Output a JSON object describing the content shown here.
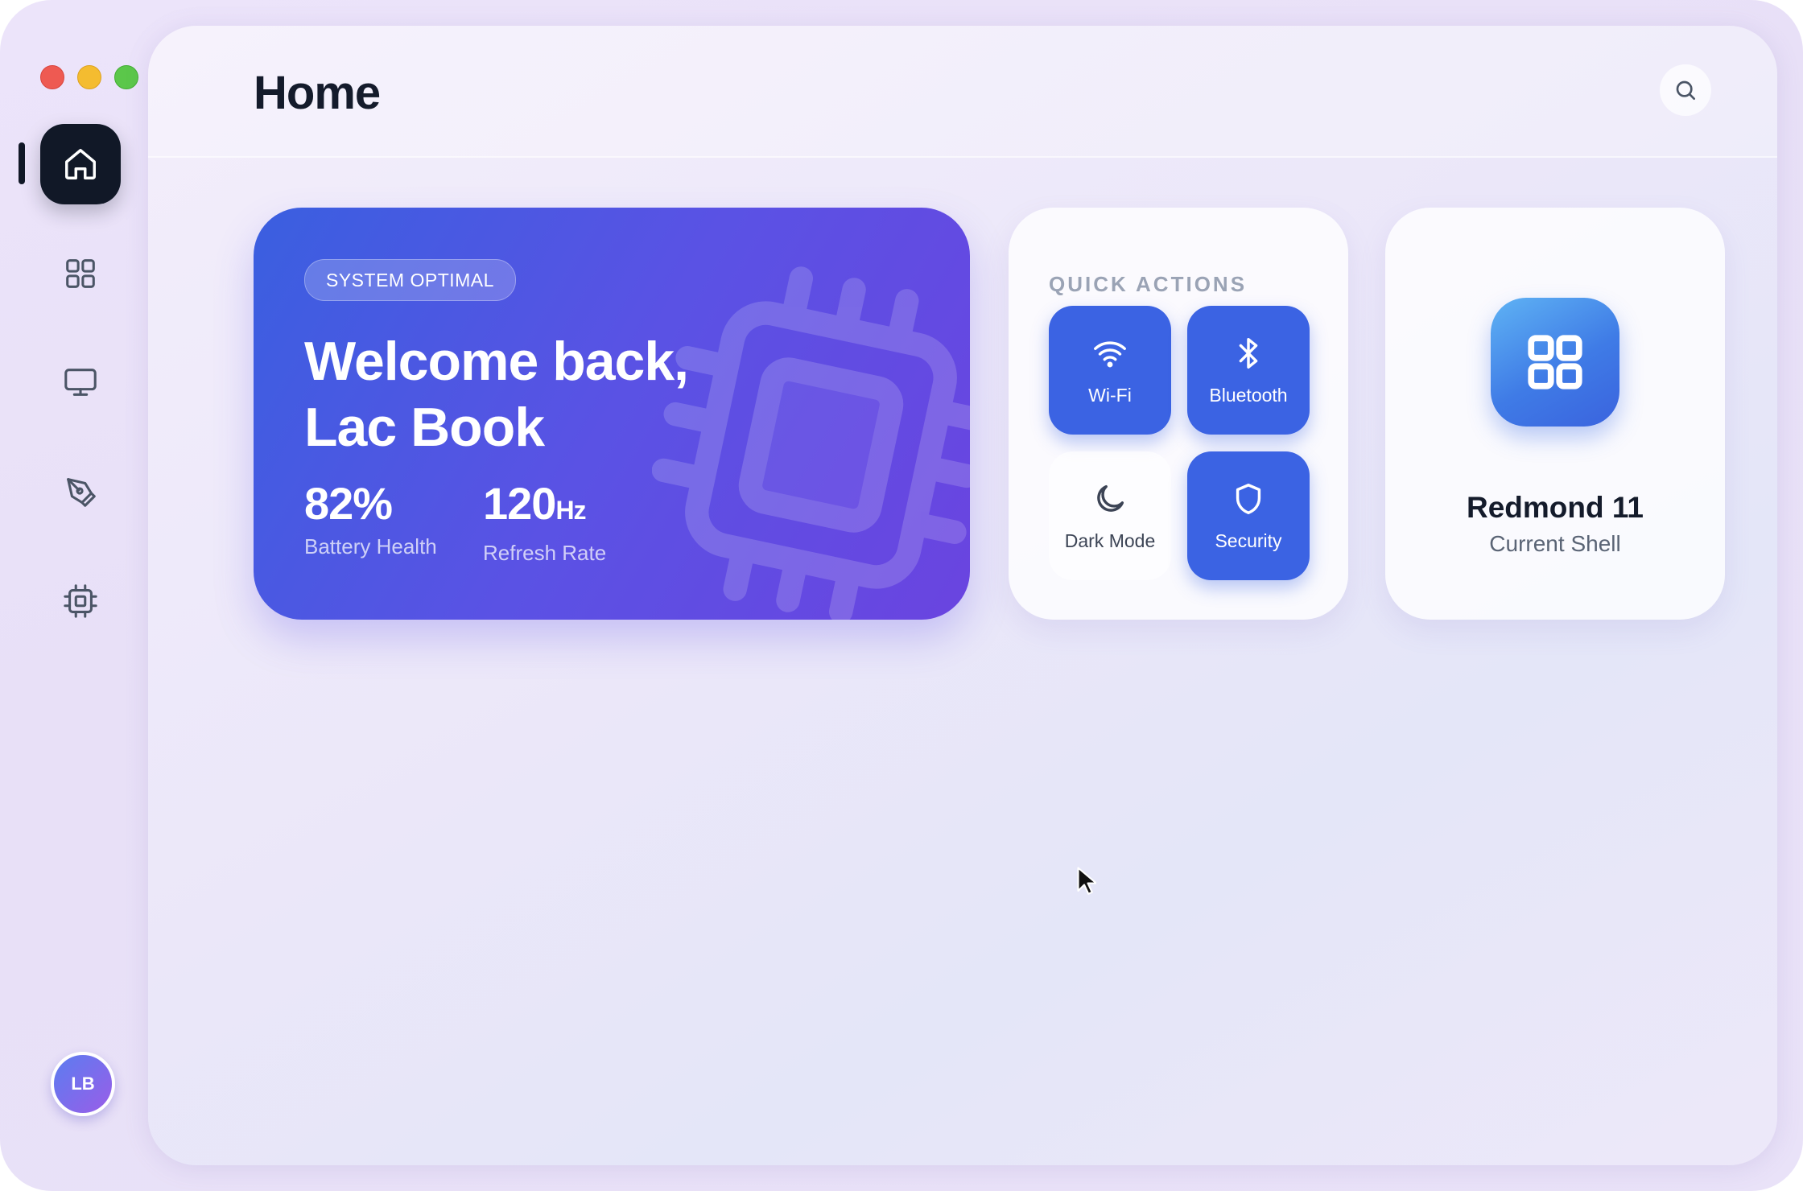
{
  "window": {
    "controls": [
      "close",
      "minimize",
      "maximize"
    ]
  },
  "sidebar": {
    "items": [
      {
        "id": "home",
        "icon": "home-icon",
        "active": true
      },
      {
        "id": "apps",
        "icon": "grid-icon",
        "active": false
      },
      {
        "id": "display",
        "icon": "monitor-icon",
        "active": false
      },
      {
        "id": "personalize",
        "icon": "pen-tool-icon",
        "active": false
      },
      {
        "id": "system",
        "icon": "cpu-icon",
        "active": false
      }
    ],
    "avatar_initials": "LB"
  },
  "header": {
    "title": "Home",
    "search_icon": "search-icon"
  },
  "hero": {
    "badge": "SYSTEM OPTIMAL",
    "title_line1": "Welcome back,",
    "title_line2": "Lac Book",
    "stats": [
      {
        "value": "82%",
        "unit": "",
        "label": "Battery Health"
      },
      {
        "value": "120",
        "unit": "Hz",
        "label": "Refresh Rate"
      }
    ],
    "gradient": [
      "#3a5fe0",
      "#6a44e0"
    ]
  },
  "quick_actions": {
    "title": "QUICK ACTIONS",
    "buttons": [
      {
        "label": "Wi-Fi",
        "icon": "wifi-icon",
        "active": true
      },
      {
        "label": "Bluetooth",
        "icon": "bluetooth-icon",
        "active": true
      },
      {
        "label": "Dark Mode",
        "icon": "moon-icon",
        "active": false
      },
      {
        "label": "Security",
        "icon": "shield-icon",
        "active": true
      }
    ],
    "accent": "#3b63e3"
  },
  "os_card": {
    "name": "Redmond 11",
    "subtitle": "Current Shell",
    "icon": "grid-logo-icon"
  }
}
